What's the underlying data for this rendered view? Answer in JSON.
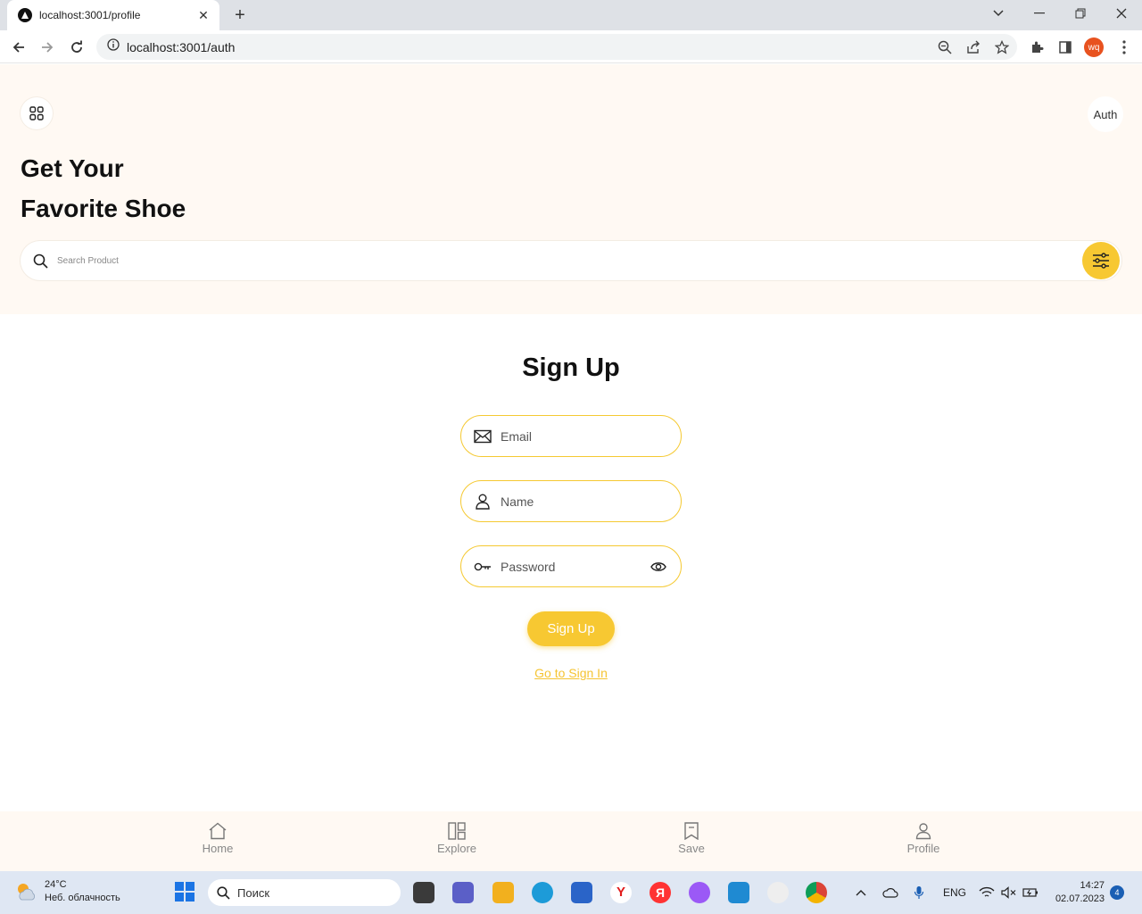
{
  "browser": {
    "tab_title": "localhost:3001/profile",
    "url": "localhost:3001/auth",
    "profile_initials": "wq"
  },
  "header": {
    "auth_label": "Auth",
    "hero_line1": "Get Your",
    "hero_line2": "Favorite Shoe",
    "search_placeholder": "Search Product"
  },
  "form": {
    "title": "Sign Up",
    "email_placeholder": "Email",
    "name_placeholder": "Name",
    "password_placeholder": "Password",
    "submit_label": "Sign Up",
    "switch_link": "Go to Sign In"
  },
  "bottom_nav": {
    "items": [
      {
        "label": "Home",
        "icon": "home-icon"
      },
      {
        "label": "Explore",
        "icon": "explore-icon"
      },
      {
        "label": "Save",
        "icon": "bookmark-icon"
      },
      {
        "label": "Profile",
        "icon": "user-icon"
      }
    ]
  },
  "taskbar": {
    "temperature": "24°C",
    "weather": "Неб. облачность",
    "search_placeholder": "Поиск",
    "language": "ENG",
    "time": "14:27",
    "date": "02.07.2023",
    "notifications": "4"
  },
  "colors": {
    "accent": "#f7c832",
    "header_bg": "#fff9f3",
    "border": "#f5c932"
  }
}
